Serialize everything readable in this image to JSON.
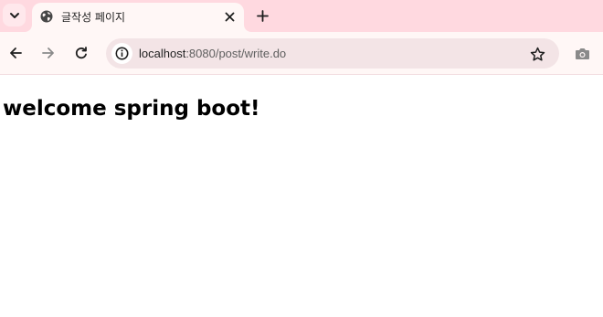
{
  "browser": {
    "tabs": [
      {
        "title": "글작성 페이지",
        "favicon": "globe-icon",
        "active": true
      }
    ],
    "controls": {
      "tab_search_icon": "chevron-down-icon",
      "close_icon": "close-icon",
      "new_tab_icon": "plus-icon",
      "back_icon": "arrow-left-icon",
      "forward_icon": "arrow-right-icon",
      "reload_icon": "reload-icon",
      "site_info_icon": "info-icon",
      "bookmark_icon": "star-icon",
      "screenshot_icon": "camera-icon"
    },
    "address_bar": {
      "host": "localhost",
      "rest": ":8080/post/write.do"
    },
    "colors": {
      "tabstrip": "#ffd9e0",
      "toolbar": "#fff7f6",
      "omnibox": "#f3e4e6"
    }
  },
  "page": {
    "heading": "welcome spring boot!"
  }
}
